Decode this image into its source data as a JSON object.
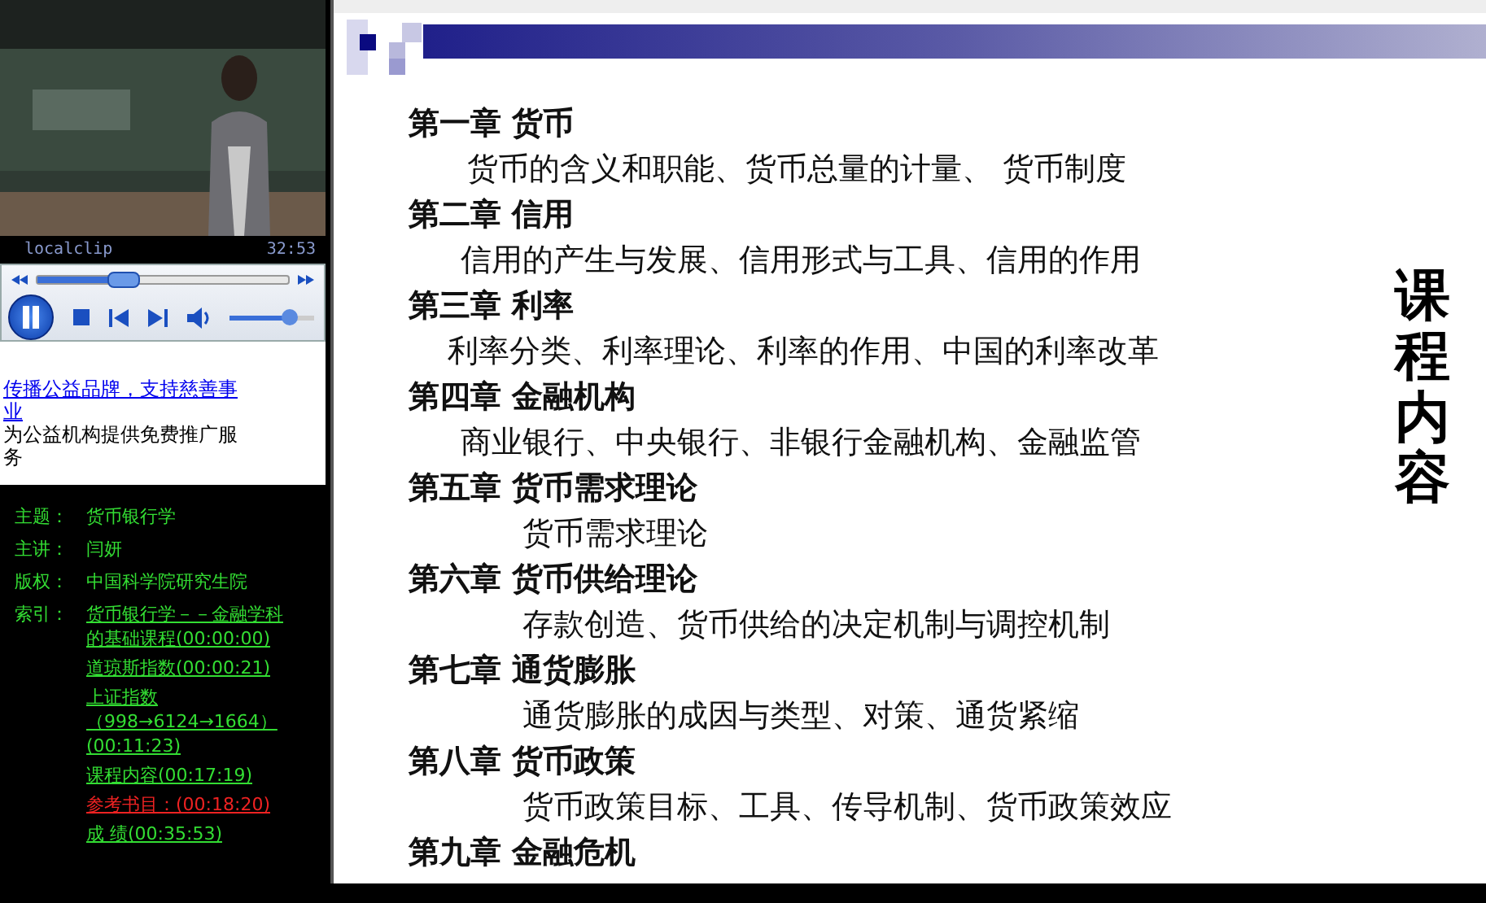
{
  "player": {
    "caption": "localclip",
    "time": "32:53",
    "seek": {
      "level": 0.34
    },
    "volume": {
      "level": 0.72
    },
    "playing": true
  },
  "ad": {
    "link": "传播公益品牌，支持慈善事业",
    "text": "为公益机构提供免费推广服务"
  },
  "info": {
    "fields": [
      {
        "label": "主题：",
        "value": "货币银行学"
      },
      {
        "label": "主讲：",
        "value": "闫妍"
      },
      {
        "label": "版权：",
        "value": "中国科学院研究生院"
      }
    ],
    "index_label": "索引：",
    "index": [
      {
        "text": "货币银行学－－金融学科的基础课程(00:00:00)",
        "selected": false
      },
      {
        "text": "道琼斯指数(00:00:21)",
        "selected": false
      },
      {
        "text": "上证指数（998→6124→1664）(00:11:23)",
        "selected": false
      },
      {
        "text": "课程内容(00:17:19)",
        "selected": false
      },
      {
        "text": "参考书目：(00:18:20)",
        "selected": true
      },
      {
        "text": "成 绩(00:35:53)",
        "selected": false
      }
    ]
  },
  "slide": {
    "side_title": "课程内容",
    "chapters": [
      {
        "title": "第一章 货币",
        "topics": "货币的含义和职能、货币总量的计量、 货币制度"
      },
      {
        "title": "第二章 信用",
        "topics": "信用的产生与发展、信用形式与工具、信用的作用"
      },
      {
        "title": "第三章 利率",
        "topics": "利率分类、利率理论、利率的作用、中国的利率改革"
      },
      {
        "title": "第四章  金融机构",
        "topics": "商业银行、中央银行、非银行金融机构、金融监管"
      },
      {
        "title": "第五章  货币需求理论",
        "topics": "货币需求理论"
      },
      {
        "title": "第六章  货币供给理论",
        "topics": "存款创造、货币供给的决定机制与调控机制"
      },
      {
        "title": "第七章  通货膨胀",
        "topics": "通货膨胀的成因与类型、对策、通货紧缩"
      },
      {
        "title": "第八章  货币政策",
        "topics": "货币政策目标、工具、传导机制、货币政策效应"
      },
      {
        "title": "第九章  金融危机"
      }
    ]
  }
}
